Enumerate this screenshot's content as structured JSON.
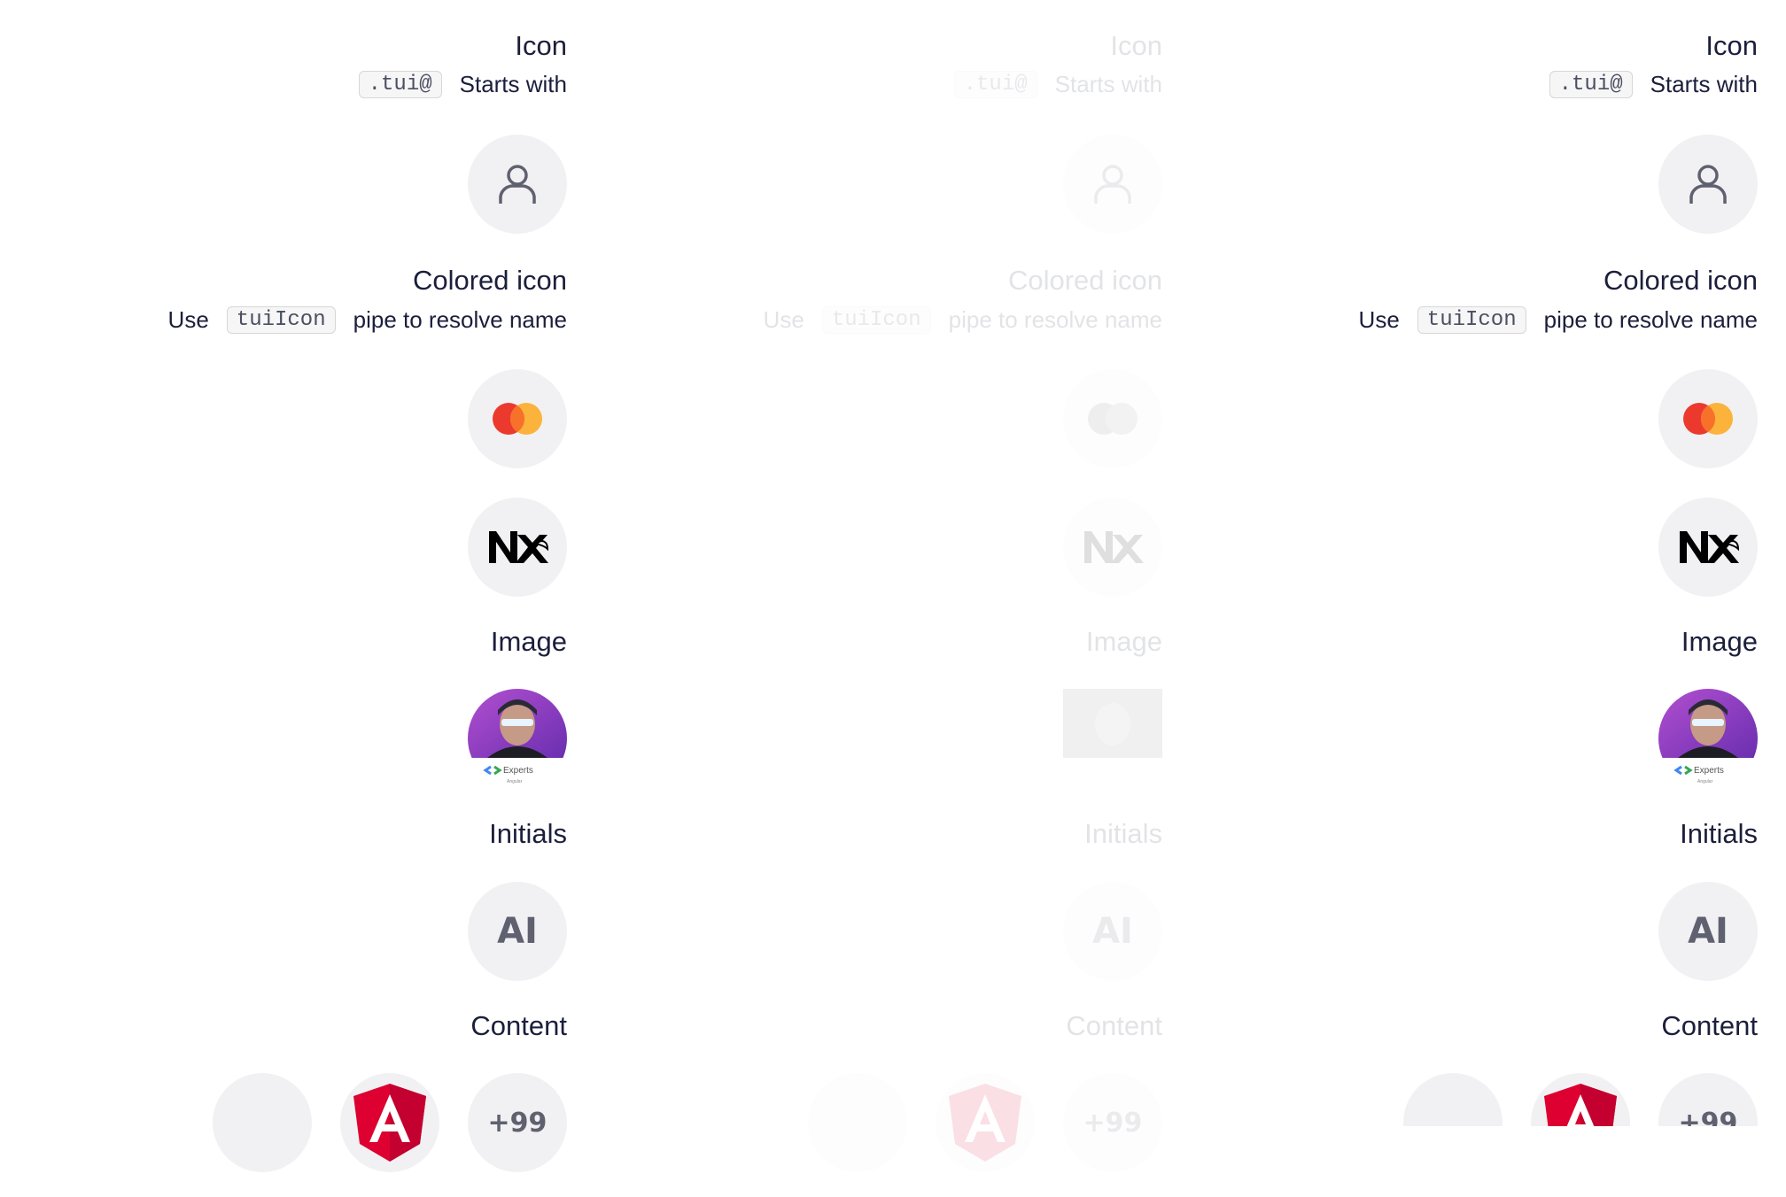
{
  "sections": {
    "icon": {
      "title": "Icon",
      "code": ".tui@",
      "suffix": "Starts with",
      "icon_name": "user-icon"
    },
    "colored_icon": {
      "title": "Colored icon",
      "prefix": "Use",
      "code": "tuiIcon",
      "suffix": "pipe to resolve name",
      "icons": [
        "mastercard-icon",
        "nx-logo-icon"
      ]
    },
    "image": {
      "title": "Image",
      "caption": "Experts",
      "subcaption": "Angular"
    },
    "initials": {
      "title": "Initials",
      "value": "AI"
    },
    "content": {
      "title": "Content",
      "items": [
        "",
        "angular-logo-icon",
        "+99"
      ]
    }
  },
  "colors": {
    "avatar_bg": "#f1f1f3",
    "text": "#1b1f3b",
    "mastercard_red": "#eb3a2d",
    "mastercard_orange": "#fbb33b",
    "angular_red": "#dd0031"
  }
}
